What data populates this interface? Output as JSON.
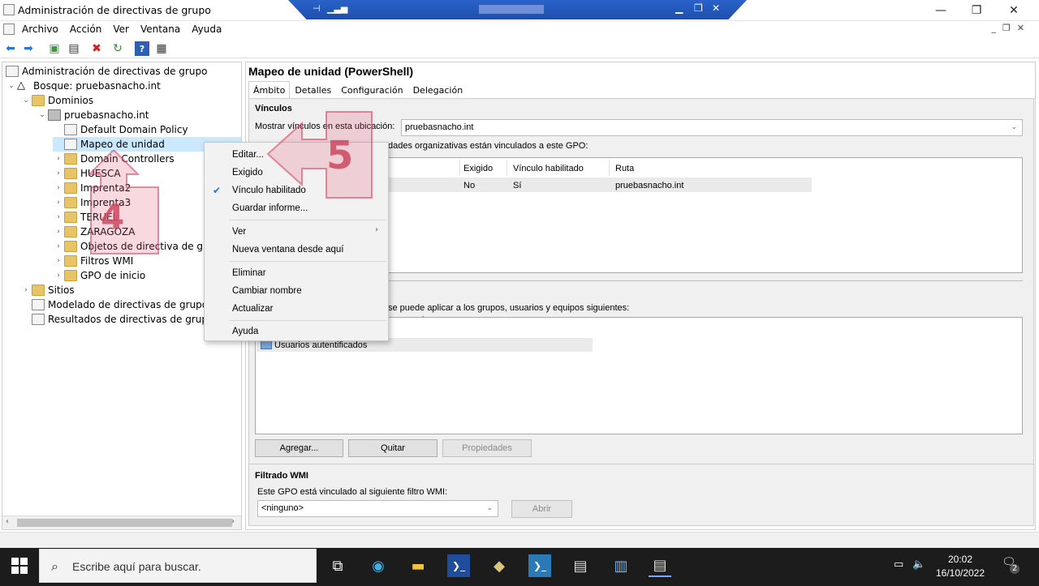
{
  "window": {
    "title": "Administración de directivas de grupo",
    "minimize": "—",
    "maximize": "❐",
    "close": "✕"
  },
  "menubar": [
    "Archivo",
    "Acción",
    "Ver",
    "Ventana",
    "Ayuda"
  ],
  "tree": {
    "root": "Administración de directivas de grupo",
    "forest": "Bosque: pruebasnacho.int",
    "domains": "Dominios",
    "domain": "pruebasnacho.int",
    "items": [
      "Default Domain Policy",
      "Mapeo de unidad",
      "Domain Controllers",
      "HUESCA",
      "Imprenta2",
      "Imprenta3",
      "TERUEL",
      "ZARAGOZA",
      "Objetos de directiva de grupo",
      "Filtros WMI",
      "GPO de inicio"
    ],
    "sites": "Sitios",
    "modeling": "Modelado de directivas de grupo",
    "results": "Resultados de directivas de grupo"
  },
  "gpo": {
    "title": "Mapeo de unidad (PowerShell)",
    "tabs": [
      "Ámbito",
      "Detalles",
      "Configuración",
      "Delegación"
    ],
    "links_heading": "Vínculos",
    "show_links_label": "Mostrar vínculos en esta ubicación:",
    "show_links_value": "pruebasnacho.int",
    "linked_desc": "dades organizativas están vinculados a este GPO:",
    "links_columns": [
      "Exigido",
      "Vínculo habilitado",
      "Ruta"
    ],
    "links_row": [
      "No",
      "Sí",
      "pruebasnacho.int"
    ],
    "security_desc": "se puede aplicar a los grupos, usuarios y equipos siguientes:",
    "security_entry": "Usuarios autentificados",
    "buttons": {
      "add": "Agregar...",
      "remove": "Quitar",
      "properties": "Propiedades"
    },
    "wmi_heading": "Filtrado WMI",
    "wmi_desc": "Este GPO está vinculado al siguiente filtro WMI:",
    "wmi_value": "<ninguno>",
    "wmi_open": "Abrir"
  },
  "context_menu": {
    "items": [
      "Editar...",
      "Exigido",
      "Vínculo habilitado",
      "Guardar informe...",
      "Ver",
      "Nueva ventana desde aquí",
      "Eliminar",
      "Cambiar nombre",
      "Actualizar",
      "Ayuda"
    ],
    "checked_item": "Vínculo habilitado"
  },
  "annotations": {
    "step4": "4",
    "step5": "5"
  },
  "taskbar": {
    "search_placeholder": "Escribe aquí para buscar.",
    "time": "20:02",
    "date": "16/10/2022",
    "notifications": "2"
  }
}
